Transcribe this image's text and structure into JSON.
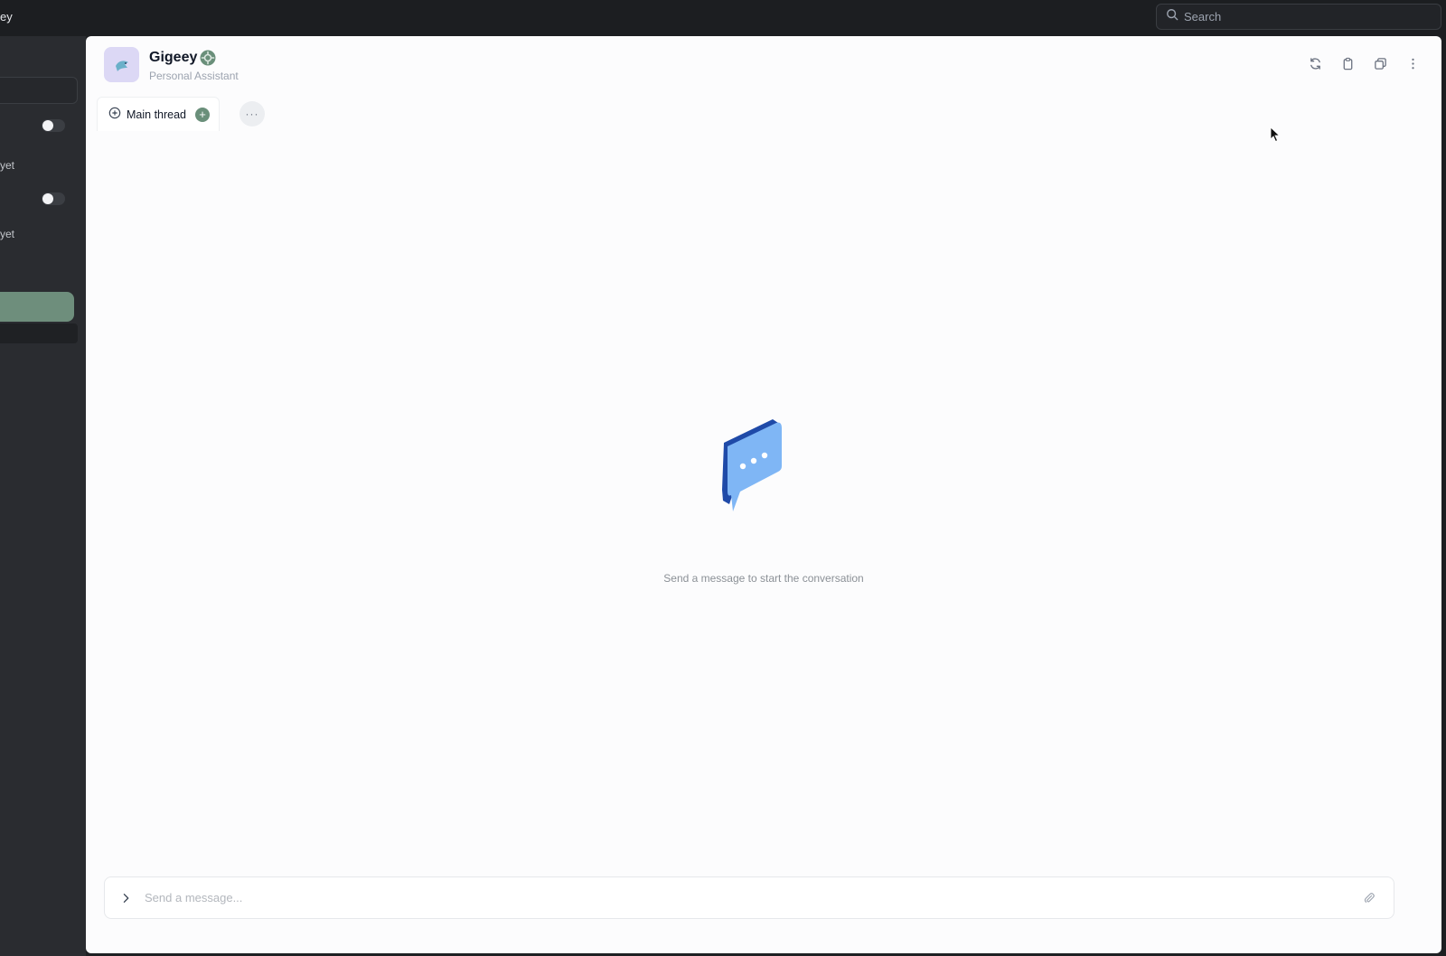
{
  "app": {
    "name": "ey"
  },
  "search": {
    "placeholder": "Search"
  },
  "sidebar": {
    "text_1": "yet",
    "text_2": "yet"
  },
  "header": {
    "title": "Gigeey",
    "subtitle": "Personal Assistant"
  },
  "tabs": [
    {
      "label": "Main thread"
    }
  ],
  "more_label": "···",
  "empty_state": {
    "message": "Send a message to start the conversation"
  },
  "composer": {
    "placeholder": "Send a message..."
  },
  "colors": {
    "accent_green": "#6a8f7a",
    "bubble_light": "#7fb6f5",
    "bubble_dark": "#1f4aa8"
  }
}
